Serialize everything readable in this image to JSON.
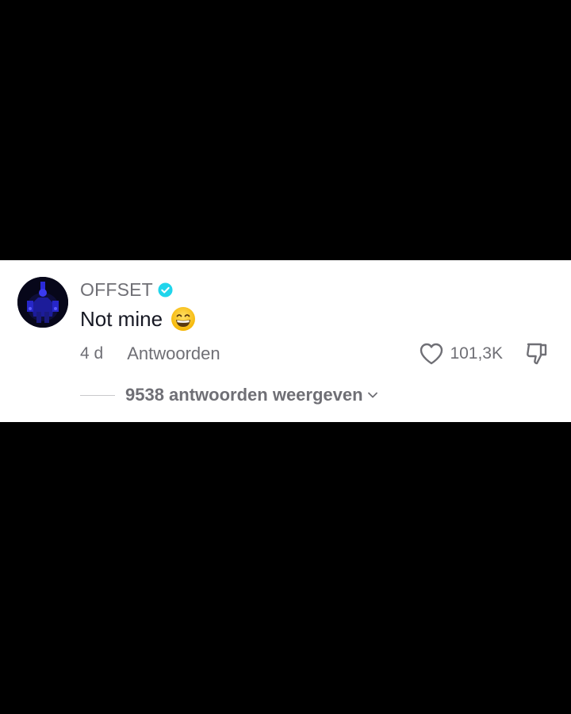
{
  "comment": {
    "username": "OFFSET",
    "verified": true,
    "text": "Not mine",
    "emoji": "grinning-face-with-smiling-eyes",
    "time": "4 d",
    "reply_label": "Antwoorden",
    "like_count": "101,3K",
    "view_replies_label": "9538 antwoorden weergeven"
  },
  "colors": {
    "background": "#000000",
    "card": "#ffffff",
    "text_primary": "#161823",
    "text_secondary": "#6f6f75",
    "verified_badge": "#20d5ec"
  },
  "icons": {
    "verified": "verified-badge-icon",
    "like": "heart-outline-icon",
    "dislike": "thumbs-down-icon",
    "expand": "chevron-down-icon"
  }
}
